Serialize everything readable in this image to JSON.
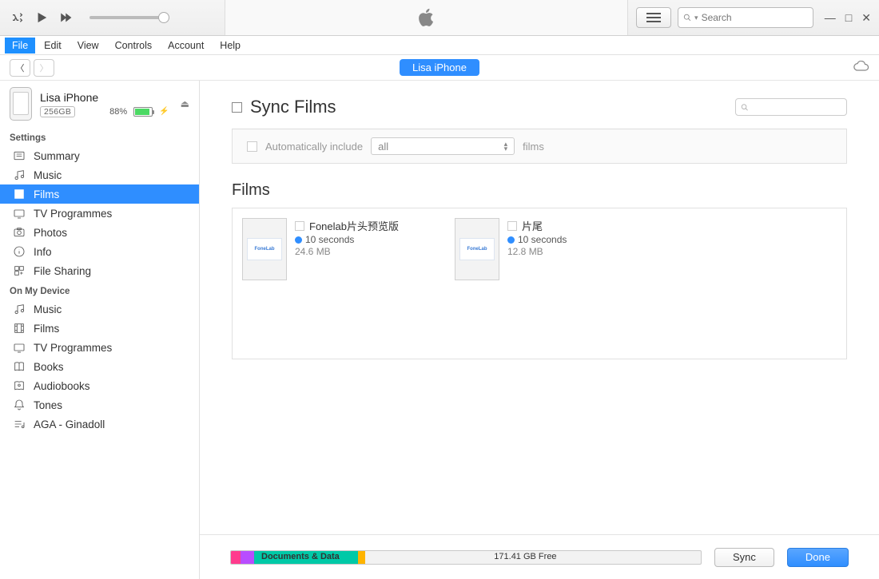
{
  "search_placeholder": "Search",
  "menus": {
    "file": "File",
    "edit": "Edit",
    "view": "View",
    "controls": "Controls",
    "account": "Account",
    "help": "Help"
  },
  "device_pill": "Lisa iPhone",
  "device": {
    "name": "Lisa iPhone",
    "capacity": "256GB",
    "battery_pct": "88%"
  },
  "sidebar": {
    "settings_label": "Settings",
    "on_device_label": "On My Device",
    "settings": [
      {
        "label": "Summary"
      },
      {
        "label": "Music"
      },
      {
        "label": "Films"
      },
      {
        "label": "TV Programmes"
      },
      {
        "label": "Photos"
      },
      {
        "label": "Info"
      },
      {
        "label": "File Sharing"
      }
    ],
    "on_device": [
      {
        "label": "Music"
      },
      {
        "label": "Films"
      },
      {
        "label": "TV Programmes"
      },
      {
        "label": "Books"
      },
      {
        "label": "Audiobooks"
      },
      {
        "label": "Tones"
      },
      {
        "label": "AGA - Ginadoll"
      }
    ]
  },
  "main": {
    "sync_title": "Sync Films",
    "auto_include_label": "Automatically include",
    "dropdown_value": "all",
    "auto_include_suffix": "films",
    "films_heading": "Films",
    "films": [
      {
        "title": "Fonelab片头预览版",
        "duration": "10 seconds",
        "size": "24.6 MB",
        "thumb": "FoneLab"
      },
      {
        "title": "片尾",
        "duration": "10 seconds",
        "size": "12.8 MB",
        "thumb": "FoneLab"
      }
    ]
  },
  "footer": {
    "docs_label": "Documents & Data",
    "free_label": "171.41 GB Free",
    "sync_btn": "Sync",
    "done_btn": "Done",
    "colors": {
      "apps": "#ff3b8d",
      "media": "#b84dff",
      "docs": "#00c9a7",
      "other": "#ffb400"
    }
  }
}
